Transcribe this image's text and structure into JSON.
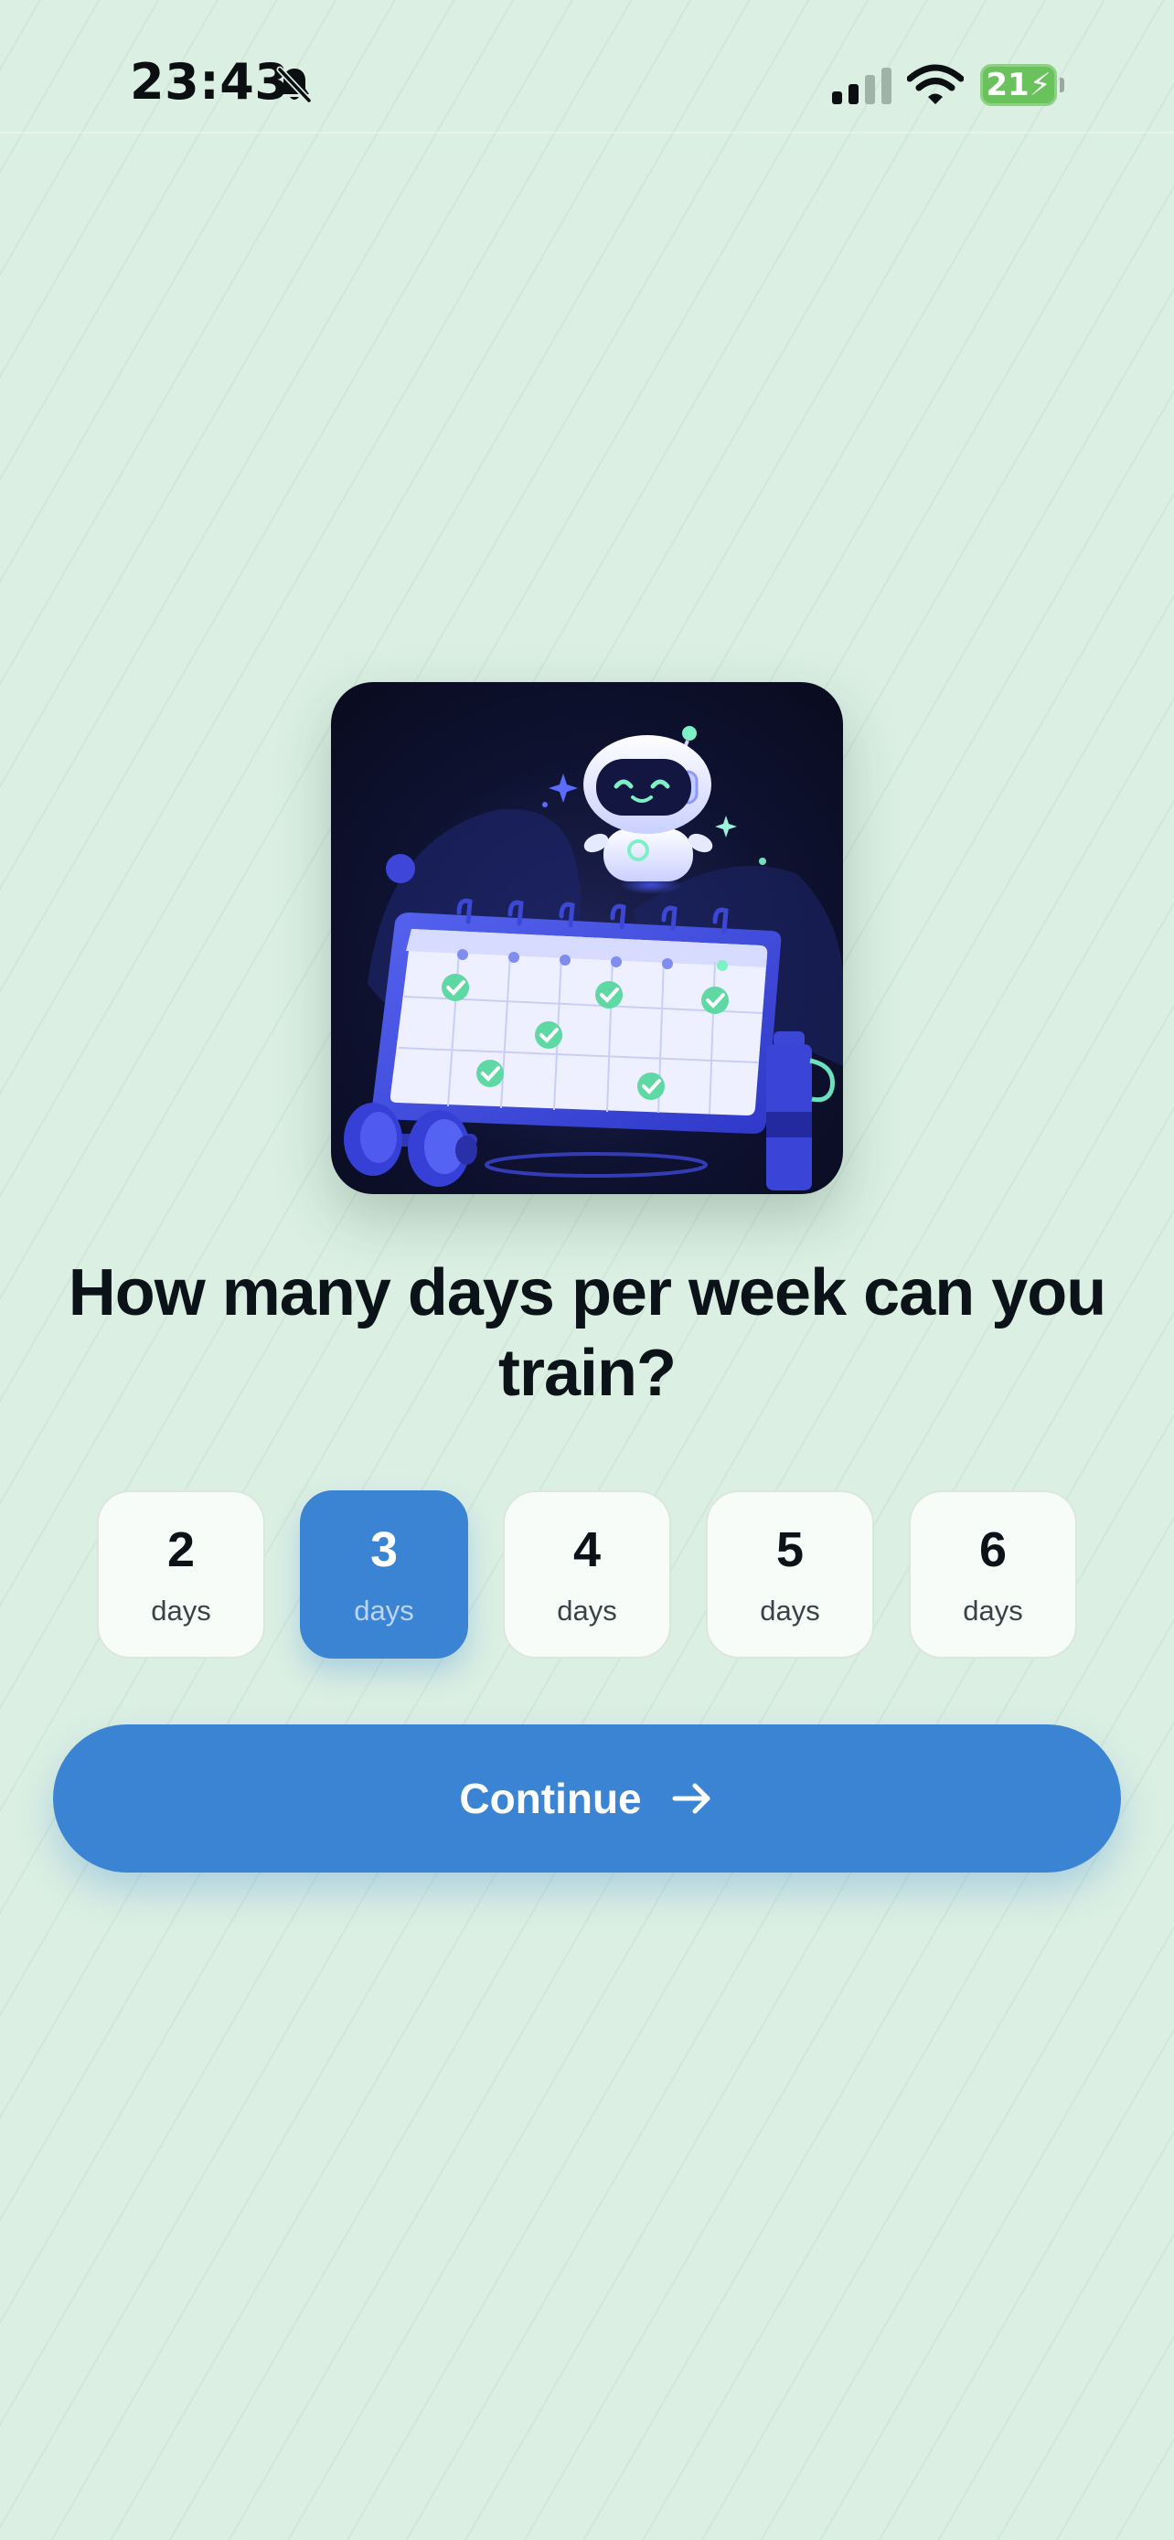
{
  "status_bar": {
    "time": "23:43",
    "battery_level": "21",
    "icons": [
      "bell-slash-icon",
      "signal-icon",
      "wifi-icon",
      "battery-charging-icon"
    ]
  },
  "illustration": {
    "icon": "robot-calendar-illustration"
  },
  "question": {
    "text": "How many days per week can you train?"
  },
  "options": [
    {
      "value": "2",
      "unit": "days",
      "selected": false
    },
    {
      "value": "3",
      "unit": "days",
      "selected": true
    },
    {
      "value": "4",
      "unit": "days",
      "selected": false
    },
    {
      "value": "5",
      "unit": "days",
      "selected": false
    },
    {
      "value": "6",
      "unit": "days",
      "selected": false
    }
  ],
  "continue_button": {
    "label": "Continue",
    "icon": "arrow-right-icon"
  },
  "colors": {
    "background": "#dbefe3",
    "accent": "#3a84d3",
    "battery": "#69c25c",
    "text": "#0c1318"
  }
}
